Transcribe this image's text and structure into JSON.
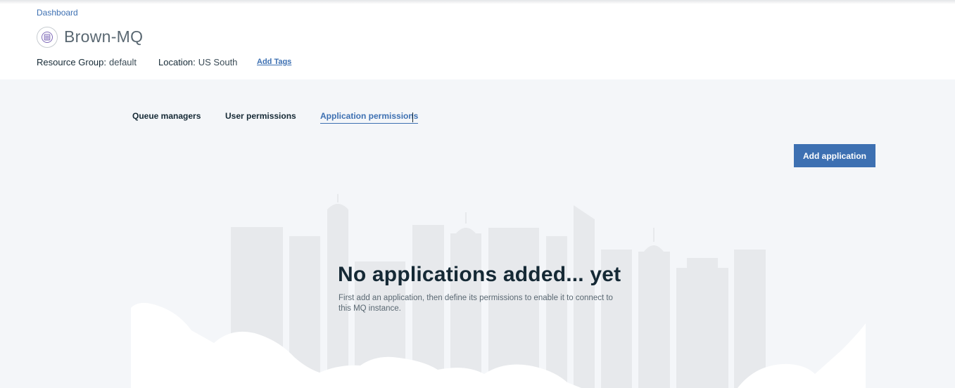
{
  "breadcrumb": {
    "label": "Dashboard"
  },
  "service": {
    "title": "Brown-MQ",
    "icon": "mq-service-icon",
    "resource_group_label": "Resource Group:",
    "resource_group_value": "default",
    "location_label": "Location:",
    "location_value": "US South",
    "add_tags_label": "Add Tags"
  },
  "tabs": [
    {
      "label": "Queue managers",
      "active": false
    },
    {
      "label": "User permissions",
      "active": false
    },
    {
      "label": "Application permissions",
      "active": true
    }
  ],
  "actions": {
    "add_application_label": "Add application"
  },
  "empty_state": {
    "title": "No applications added... yet",
    "description": "First add an application, then define its permissions to enable it to connect to this MQ instance."
  },
  "colors": {
    "accent": "#3d70b2",
    "background": "#f4f6f9",
    "header_bg": "#ffffff",
    "text_primary": "#152935",
    "text_secondary": "#5a6872",
    "building_fill": "#e7e9ec"
  }
}
